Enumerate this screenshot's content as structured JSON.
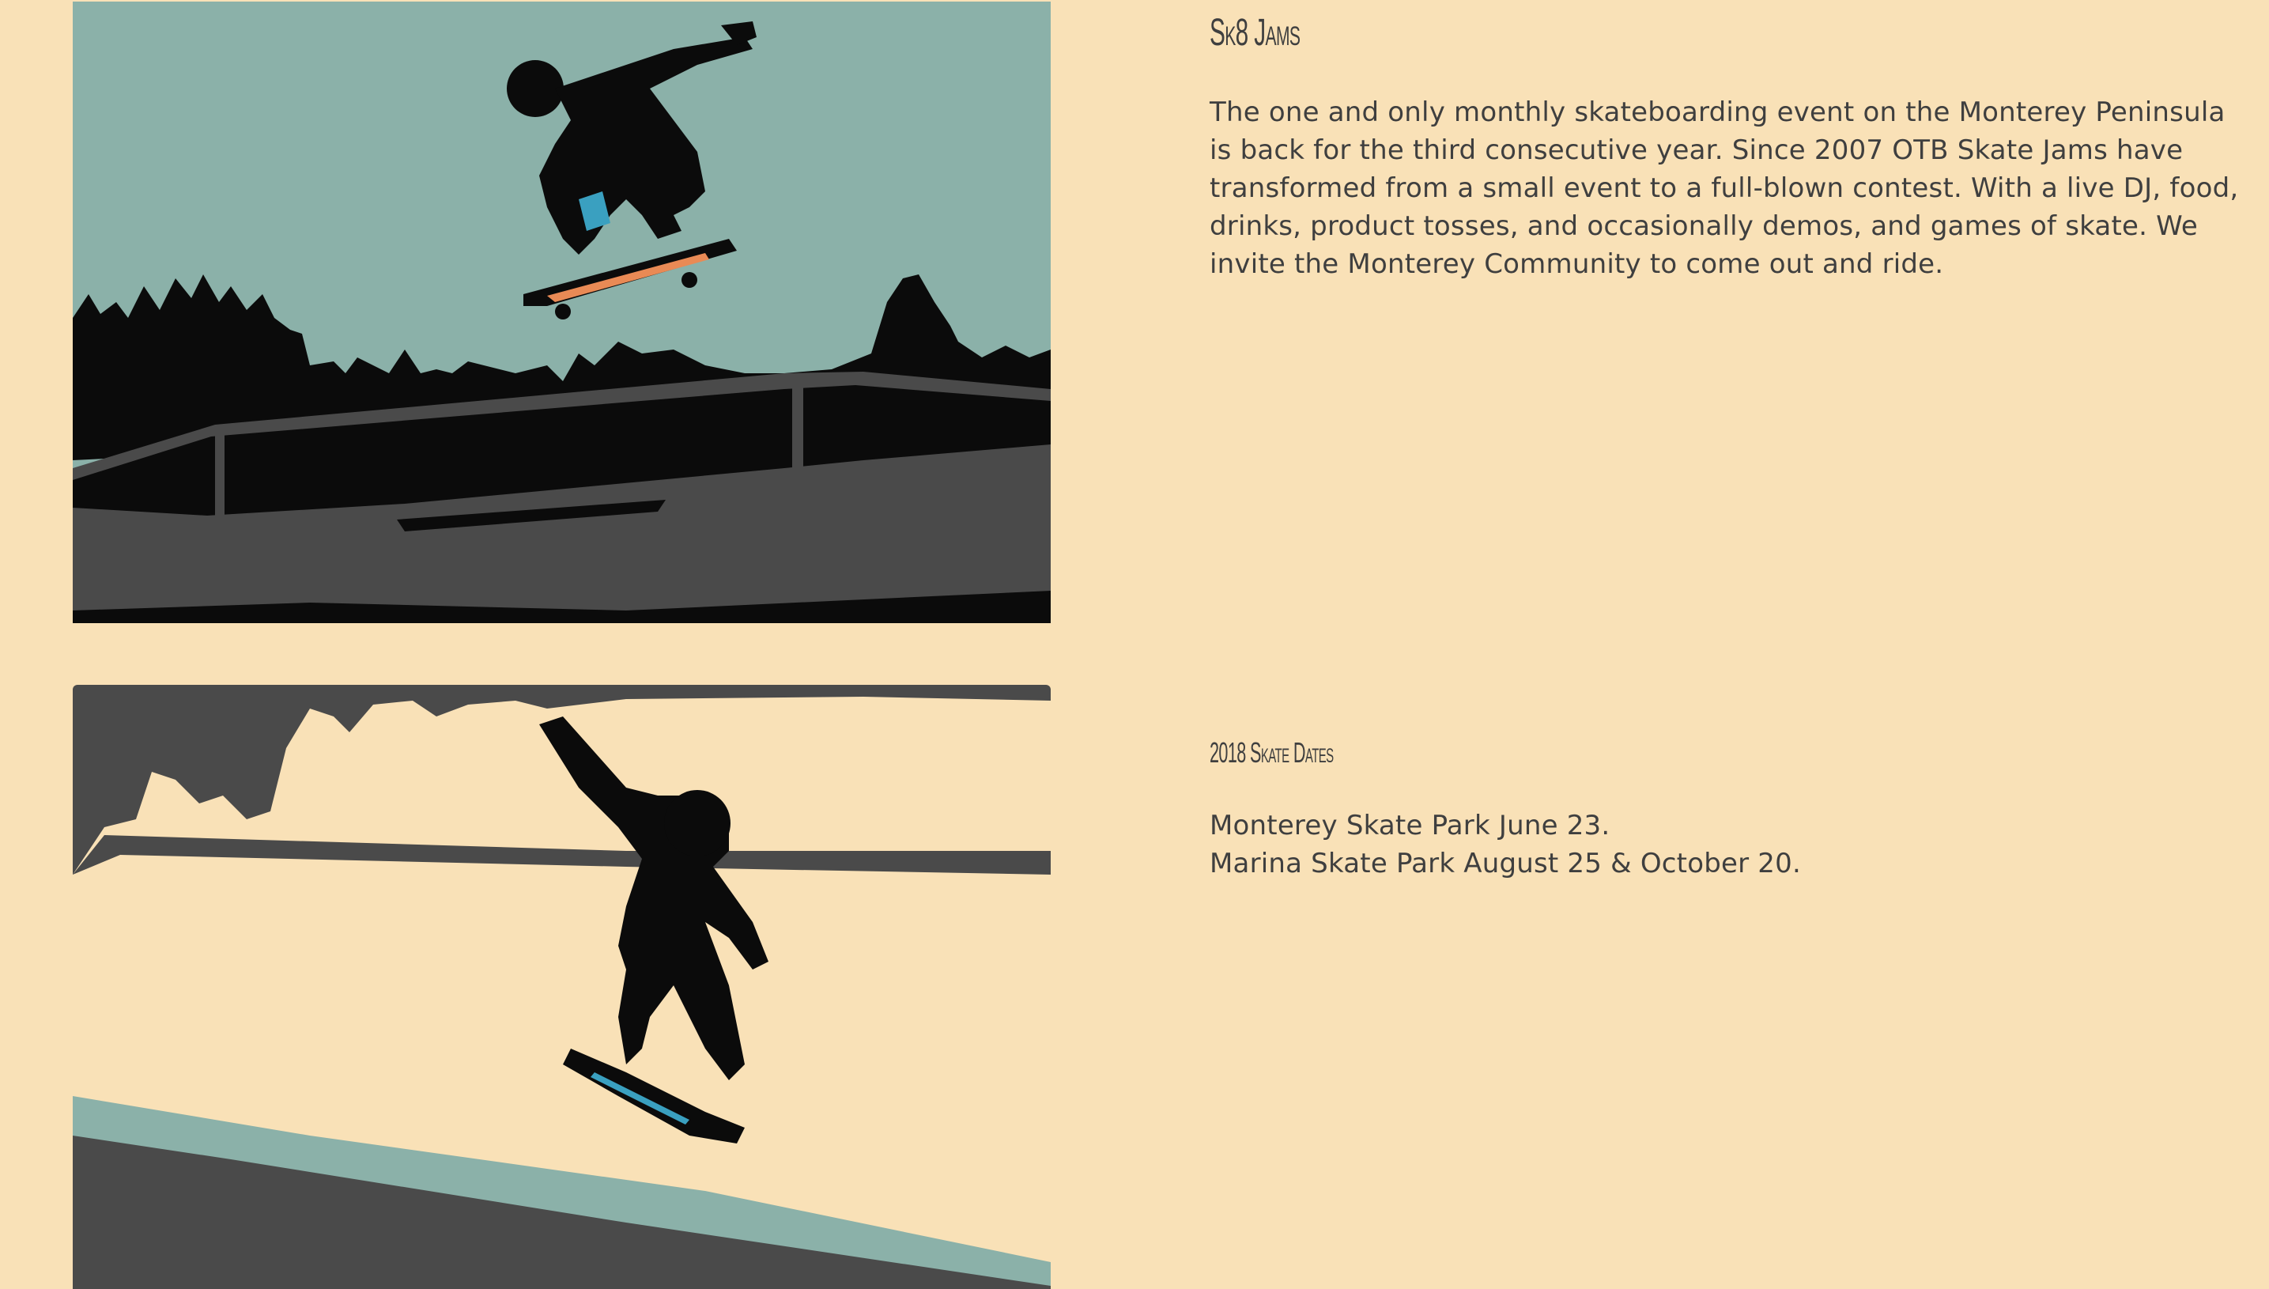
{
  "event": {
    "title": "Sk8 Jams",
    "description_lines": [
      "The one and only monthly skateboarding event on the Monterey Peninsula",
      "is back for the third consecutive year. Since 2007 OTB Skate Jams have",
      "transformed from a small event to a full-blown contest. With a live DJ, food,",
      "drinks, product tosses, and occasionally demos, and games of skate. We",
      "invite the Monterey Community to come out and ride."
    ]
  },
  "dates": {
    "title": "2018 Skate Dates",
    "items": [
      "Monterey Skate Park June 23.",
      "Marina Skate Park August 25 & October 20."
    ]
  },
  "colors": {
    "background": "#f9e1b7",
    "text": "#3f3f3f",
    "sky_teal": "#8bb1a9",
    "shadow_dark": "#4a4a4a",
    "silhouette": "#0b0b0b",
    "accent_blue": "#3aa0c0",
    "accent_orange": "#e98a55"
  },
  "images": [
    {
      "name": "skater-ollie-over-ledge"
    },
    {
      "name": "skater-wall-ride"
    }
  ]
}
